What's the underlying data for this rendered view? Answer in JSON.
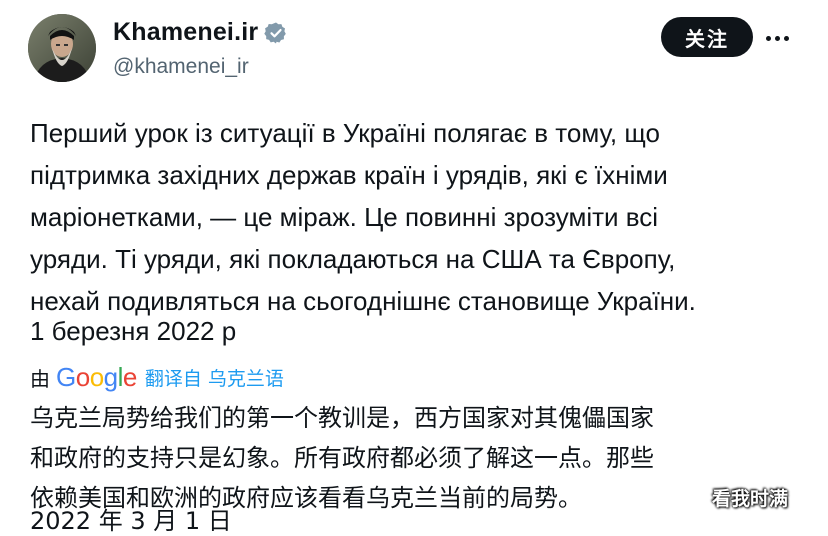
{
  "header": {
    "display_name": "Khamenei.ir",
    "handle": "@khamenei_ir",
    "follow_label": "关注",
    "verified": true
  },
  "tweet": {
    "lines": [
      "Перший урок із ситуації в Україні полягає в тому, що",
      "підтримка західних держав країн і урядів, які є їхніми",
      "маріонетками, — це міраж. Це повинні зрозуміти всі",
      "уряди. Ті уряди, які покладаються на США та Європу,",
      "нехай подивляться на сьогоднішнє становище України."
    ],
    "date": "1 березня 2022 р"
  },
  "translation": {
    "by_label": "由",
    "provider": "Google",
    "link_text": "翻译自 乌克兰语",
    "lines": [
      "乌克兰局势给我们的第一个教训是，西方国家对其傀儡国家",
      "和政府的支持只是幻象。所有政府都必须了解这一点。那些",
      "依赖美国和欧洲的政府应该看看乌克兰当前的局势。"
    ],
    "date": "2022 年 3 月 1 日"
  },
  "watermark": "看我时满",
  "colors": {
    "text": "#0f1419",
    "secondary": "#536471",
    "link": "#1d9bf0",
    "verified_badge": "#829aab"
  }
}
